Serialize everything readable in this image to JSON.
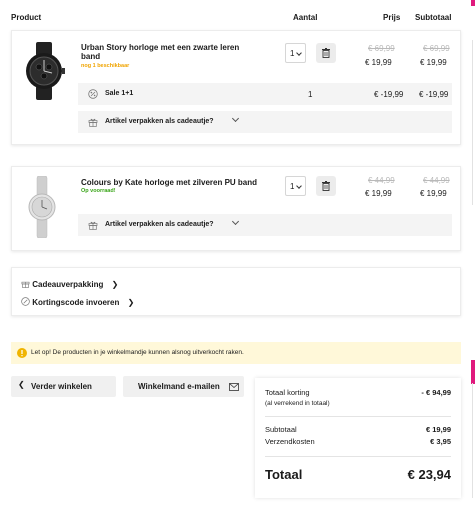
{
  "header": {
    "product": "Product",
    "quantity": "Aantal",
    "price": "Prijs",
    "subtotal": "Subtotaal"
  },
  "items": [
    {
      "name_line1": "Urban Story horloge met een zwarte leren",
      "name_line2": "band",
      "stock": "nog 1 beschikbaar",
      "qty": "1",
      "old_price": "€ 69,99",
      "price": "€ 19,99",
      "old_subtotal": "€ 69,99",
      "subtotal": "€ 19,99",
      "promo": {
        "label": "Sale 1+1",
        "qty": "1",
        "price": "€ -19,99",
        "subtotal": "€ -19,99"
      },
      "gift_label": "Artikel verpakken als cadeautje?"
    },
    {
      "name_line1": "Colours by Kate horloge met zilveren PU band",
      "stock": "Op voorraad!",
      "qty": "1",
      "old_price": "€ 44,99",
      "price": "€ 19,99",
      "old_subtotal": "€ 44,99",
      "subtotal": "€ 19,99",
      "gift_label": "Artikel verpakken als cadeautje?"
    }
  ],
  "extras": {
    "gift_wrap": "Cadeauverpakking",
    "discount_code": "Kortingscode invoeren"
  },
  "notice": "Let op! De producten in je winkelmandje kunnen alsnog uitverkocht raken.",
  "buttons": {
    "continue": "Verder winkelen",
    "email": "Winkelmand e-mailen"
  },
  "summary": {
    "discount_label": "Totaal korting",
    "discount_value": "- € 94,99",
    "discount_note": "(al verrekend in totaal)",
    "subtotal_label": "Subtotaal",
    "subtotal_value": "€ 19,99",
    "shipping_label": "Verzendkosten",
    "shipping_value": "€ 3,95",
    "total_label": "Totaal",
    "total_value": "€ 23,94"
  },
  "colors": {
    "accent_pink": "#e0197d",
    "stock_orange": "#f0a400",
    "stock_green": "#3aa519",
    "notice_bg": "#fff8d9",
    "notice_icon": "#f0b400"
  }
}
